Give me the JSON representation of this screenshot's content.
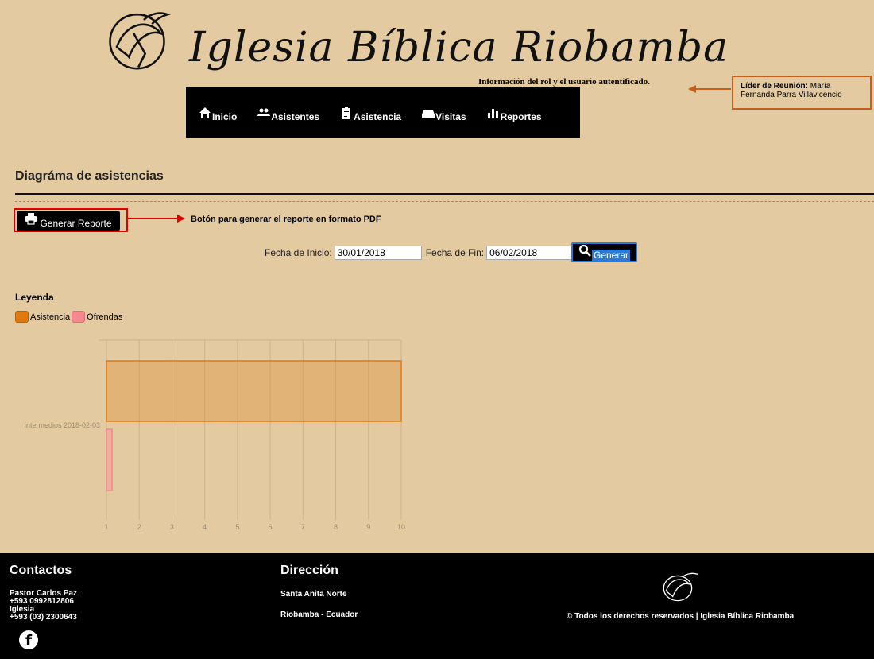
{
  "header": {
    "site_title": "Iglesia Bíblica Riobamba",
    "auth_note": "Información del rol y el usuario autentificado.",
    "user_role": "Líder de Reunión:",
    "user_name_line1": "María",
    "user_name_line2": "Fernanda Parra Villavicencio"
  },
  "nav": [
    {
      "label": "Inicio",
      "icon": "home-icon"
    },
    {
      "label": "Asistentes",
      "icon": "users-icon"
    },
    {
      "label": "Asistencia",
      "icon": "clipboard-icon"
    },
    {
      "label": "Visitas",
      "icon": "inbox-icon"
    },
    {
      "label": "Reportes",
      "icon": "bar-chart-icon"
    }
  ],
  "page": {
    "title": "Diagráma de asistencias",
    "report_button": "Generar Reporte",
    "report_note": "Botón para generar el reporte en formato PDF",
    "start_label": "Fecha de Inicio:",
    "start_value": "30/01/2018",
    "end_label": "Fecha de Fin:",
    "end_value": "06/02/2018",
    "generate_button": "Generar",
    "legend_title": "Leyenda"
  },
  "colors": {
    "background": "#e3caa0",
    "accent_orange": "#e07a10",
    "accent_pink": "#f3888e",
    "highlight_red": "#e00000",
    "generate_blue": "#2a7ad8"
  },
  "chart_data": {
    "type": "bar",
    "orientation": "horizontal",
    "categories": [
      "Intermedios 2018-02-03"
    ],
    "series": [
      {
        "name": "Asistencia",
        "values": [
          10
        ],
        "color": "#e07a10"
      },
      {
        "name": "Ofrendas",
        "values": [
          1
        ],
        "color": "#f3888e"
      }
    ],
    "xlim": [
      1,
      10
    ],
    "xticks": [
      1,
      2,
      3,
      4,
      5,
      6,
      7,
      8,
      9,
      10
    ],
    "grid": true,
    "legend": "top-left"
  },
  "footer": {
    "contacts_title": "Contactos",
    "pastor": "Pastor Carlos Paz",
    "pastor_phone": "+593 0992812806",
    "church": "Iglesia",
    "church_phone": "+593 (03) 2300643",
    "address_title": "Dirección",
    "address_line1": "Santa Anita Norte",
    "address_line2": "Riobamba - Ecuador",
    "copyright": "© Todos los derechos reservados | Iglesia Bíblica Riobamba"
  }
}
